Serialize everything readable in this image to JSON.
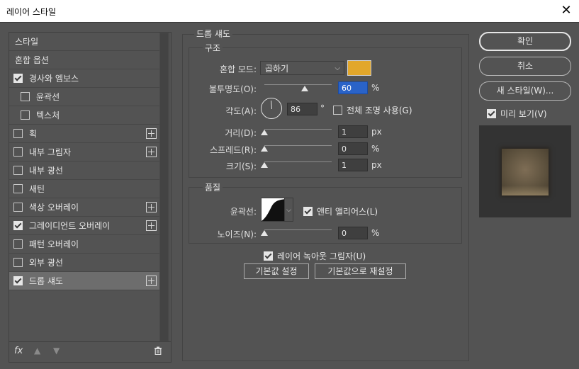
{
  "window": {
    "title": "레이어 스타일",
    "close_icon": "close-icon"
  },
  "left_panel": {
    "items": [
      {
        "label": "스타일",
        "checkbox": false,
        "has_checkbox": false,
        "plus": false
      },
      {
        "label": "혼합 옵션",
        "checkbox": false,
        "has_checkbox": false,
        "plus": false
      },
      {
        "label": "경사와 엠보스",
        "checkbox": true,
        "has_checkbox": true,
        "plus": false
      },
      {
        "label": "윤곽선",
        "checkbox": false,
        "has_checkbox": true,
        "plus": false,
        "indent": true
      },
      {
        "label": "텍스처",
        "checkbox": false,
        "has_checkbox": true,
        "plus": false,
        "indent": true
      },
      {
        "label": "획",
        "checkbox": false,
        "has_checkbox": true,
        "plus": true
      },
      {
        "label": "내부 그림자",
        "checkbox": false,
        "has_checkbox": true,
        "plus": true
      },
      {
        "label": "내부 광선",
        "checkbox": false,
        "has_checkbox": true,
        "plus": false
      },
      {
        "label": "새틴",
        "checkbox": false,
        "has_checkbox": true,
        "plus": false
      },
      {
        "label": "색상 오버레이",
        "checkbox": false,
        "has_checkbox": true,
        "plus": true
      },
      {
        "label": "그레이디언트 오버레이",
        "checkbox": true,
        "has_checkbox": true,
        "plus": true
      },
      {
        "label": "패턴 오버레이",
        "checkbox": false,
        "has_checkbox": true,
        "plus": false
      },
      {
        "label": "외부 광선",
        "checkbox": false,
        "has_checkbox": true,
        "plus": false
      },
      {
        "label": "드롭 섀도",
        "checkbox": true,
        "has_checkbox": true,
        "plus": true,
        "selected": true
      }
    ],
    "footer": {
      "fx": "fx",
      "up_icon": "arrow-up-icon",
      "down_icon": "arrow-down-icon",
      "trash_icon": "trash-icon"
    }
  },
  "drop_shadow": {
    "section_title": "드롭 섀도",
    "structure": {
      "title": "구조",
      "blend_mode_label": "혼합 모드:",
      "blend_mode_value": "곱하기",
      "shadow_color": "#e2a72b",
      "opacity_label": "불투명도(O):",
      "opacity_value": "60",
      "opacity_unit": "%",
      "opacity_level": 0.6,
      "angle_label": "각도(A):",
      "angle_value": "86",
      "angle_unit": "°",
      "global_light_label": "전체 조명 사용(G)",
      "global_light_checked": false,
      "distance_label": "거리(D):",
      "distance_value": "1",
      "distance_unit": "px",
      "spread_label": "스프레드(R):",
      "spread_value": "0",
      "spread_unit": "%",
      "size_label": "크기(S):",
      "size_value": "1",
      "size_unit": "px"
    },
    "quality": {
      "title": "품질",
      "contour_label": "윤곽선:",
      "anti_alias_label": "앤티 앨리어스(L)",
      "anti_alias_checked": true,
      "noise_label": "노이즈(N):",
      "noise_value": "0",
      "noise_unit": "%"
    },
    "knockout_label": "레이어 녹아웃 그림자(U)",
    "knockout_checked": true,
    "make_default_label": "기본값 설정",
    "reset_default_label": "기본값으로 재설정"
  },
  "right_panel": {
    "ok_label": "확인",
    "cancel_label": "취소",
    "new_style_label": "새 스타일(W)...",
    "preview_label": "미리 보기(V)",
    "preview_checked": true
  }
}
